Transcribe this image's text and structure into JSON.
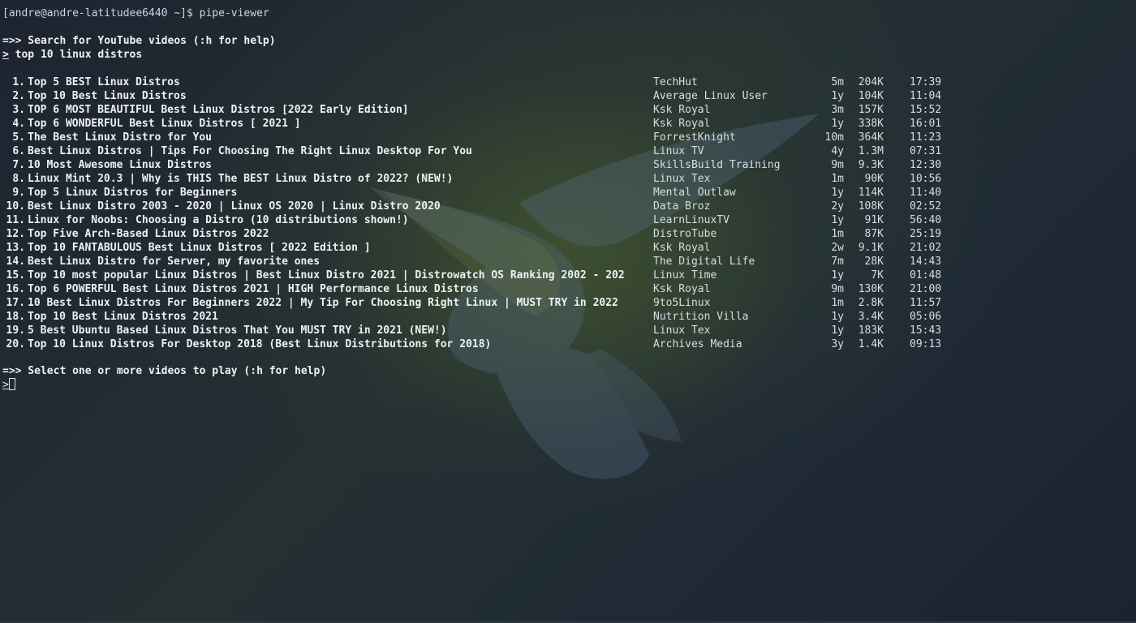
{
  "shell": {
    "user_host": "[andre@andre-latitudee6440 ~]$",
    "command": " pipe-viewer"
  },
  "search": {
    "prompt_label": "=>> Search for YouTube videos (:h for help)",
    "input_marker": ">",
    "query": " top 10 linux distros"
  },
  "results": [
    {
      "num": "1.",
      "title": "Top 5 BEST Linux Distros",
      "channel": "TechHut",
      "age": "5m",
      "views": "204K",
      "duration": "17:39"
    },
    {
      "num": "2.",
      "title": "Top 10 Best Linux Distros",
      "channel": "Average Linux User",
      "age": "1y",
      "views": "104K",
      "duration": "11:04"
    },
    {
      "num": "3.",
      "title": "TOP 6 MOST BEAUTIFUL Best Linux Distros [2022 Early Edition]",
      "channel": "Ksk Royal",
      "age": "3m",
      "views": "157K",
      "duration": "15:52"
    },
    {
      "num": "4.",
      "title": "Top 6 WONDERFUL Best Linux Distros [ 2021 ]",
      "channel": "Ksk Royal",
      "age": "1y",
      "views": "338K",
      "duration": "16:01"
    },
    {
      "num": "5.",
      "title": "The Best Linux Distro for You",
      "channel": "ForrestKnight",
      "age": "10m",
      "views": "364K",
      "duration": "11:23"
    },
    {
      "num": "6.",
      "title": "Best Linux Distros | Tips For Choosing The Right Linux Desktop For You",
      "channel": "Linux TV",
      "age": "4y",
      "views": "1.3M",
      "duration": "07:31"
    },
    {
      "num": "7.",
      "title": "10 Most Awesome Linux Distros",
      "channel": "SkillsBuild Training",
      "age": "9m",
      "views": "9.3K",
      "duration": "12:30"
    },
    {
      "num": "8.",
      "title": "Linux Mint 20.3 | Why is THIS The BEST Linux Distro of 2022? (NEW!)",
      "channel": "Linux Tex",
      "age": "1m",
      "views": "90K",
      "duration": "10:56"
    },
    {
      "num": "9.",
      "title": "Top 5 Linux Distros for Beginners",
      "channel": "Mental Outlaw",
      "age": "1y",
      "views": "114K",
      "duration": "11:40"
    },
    {
      "num": "10.",
      "title": "Best Linux Distro 2003 - 2020 | Linux OS 2020 | Linux Distro 2020",
      "channel": "Data Broz",
      "age": "2y",
      "views": "108K",
      "duration": "02:52"
    },
    {
      "num": "11.",
      "title": "Linux for Noobs: Choosing a Distro (10 distributions shown!)",
      "channel": "LearnLinuxTV",
      "age": "1y",
      "views": "91K",
      "duration": "56:40"
    },
    {
      "num": "12.",
      "title": "Top Five Arch-Based Linux Distros 2022",
      "channel": "DistroTube",
      "age": "1m",
      "views": "87K",
      "duration": "25:19"
    },
    {
      "num": "13.",
      "title": "Top 10 FANTABULOUS Best Linux Distros [ 2022 Edition ]",
      "channel": "Ksk Royal",
      "age": "2w",
      "views": "9.1K",
      "duration": "21:02"
    },
    {
      "num": "14.",
      "title": "Best Linux Distro for Server, my favorite ones",
      "channel": "The Digital Life",
      "age": "7m",
      "views": "28K",
      "duration": "14:43"
    },
    {
      "num": "15.",
      "title": "Top 10 most popular Linux Distros | Best Linux Distro 2021 | Distrowatch OS Ranking 2002 - 202",
      "channel": "Linux Time",
      "age": "1y",
      "views": "7K",
      "duration": "01:48"
    },
    {
      "num": "16.",
      "title": "Top 6 POWERFUL Best Linux Distros 2021 | HIGH Performance Linux Distros",
      "channel": "Ksk Royal",
      "age": "9m",
      "views": "130K",
      "duration": "21:00"
    },
    {
      "num": "17.",
      "title": "10 Best Linux Distros For Beginners 2022 | My Tip For Choosing Right Linux | MUST TRY in 2022",
      "channel": "9to5Linux",
      "age": "1m",
      "views": "2.8K",
      "duration": "11:57"
    },
    {
      "num": "18.",
      "title": "Top 10 Best Linux Distros 2021",
      "channel": "Nutrition Villa",
      "age": "1y",
      "views": "3.4K",
      "duration": "05:06"
    },
    {
      "num": "19.",
      "title": "5 Best Ubuntu Based Linux Distros That You MUST TRY in 2021 (NEW!)",
      "channel": "Linux Tex",
      "age": "1y",
      "views": "183K",
      "duration": "15:43"
    },
    {
      "num": "20.",
      "title": "Top 10 Linux Distros For Desktop 2018 (Best Linux Distributions for 2018)",
      "channel": "Archives Media",
      "age": "3y",
      "views": "1.4K",
      "duration": "09:13"
    }
  ],
  "select": {
    "prompt_label": "=>> Select one or more videos to play (:h for help)",
    "input_marker": ">",
    "value": ""
  },
  "colors": {
    "text": "#dfe3ea",
    "background": "#1e2733",
    "wallpaper_accent": "#4a602c"
  },
  "icons": {
    "wallpaper": "hummingbird-icon"
  }
}
